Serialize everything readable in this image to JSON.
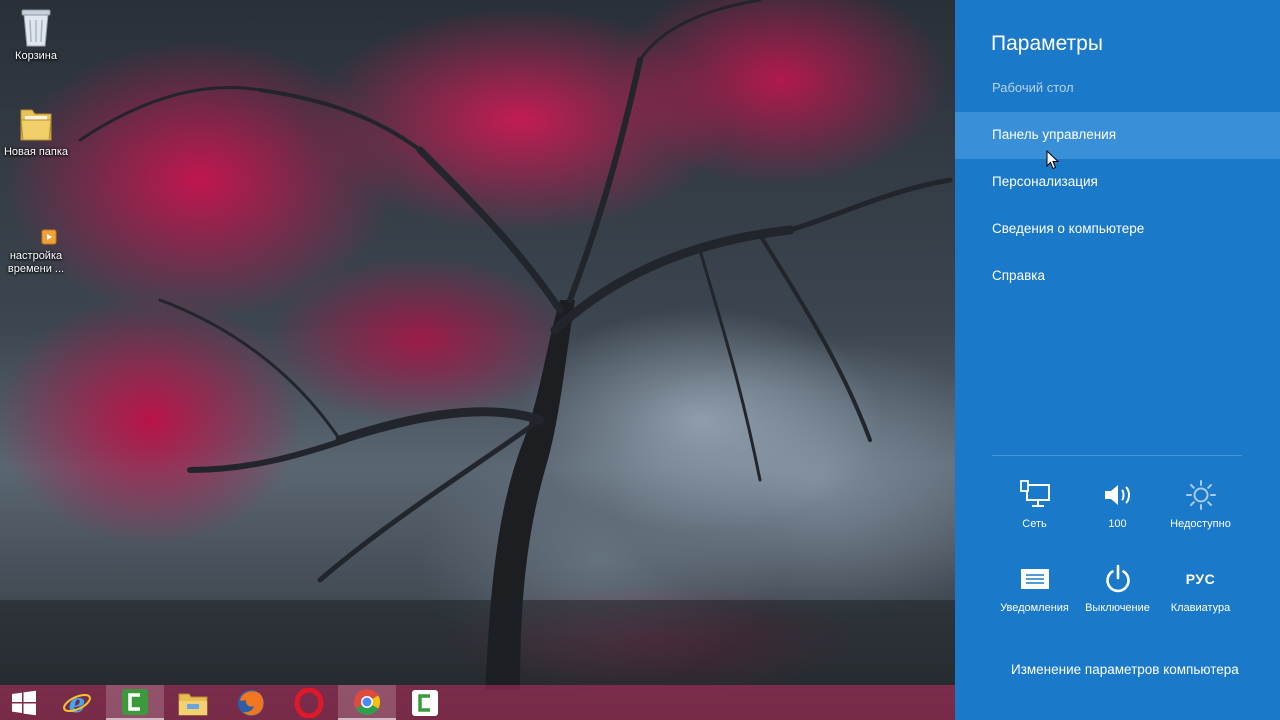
{
  "desktop": {
    "icons": [
      {
        "label": "Корзина",
        "icon": "recycle-bin-icon"
      },
      {
        "label": "Новая папка",
        "icon": "folder-icon"
      },
      {
        "label_line1": "настройка",
        "label_line2": "времени ...",
        "icon": "shortcut-icon"
      }
    ]
  },
  "taskbar": {
    "items": [
      {
        "icon": "windows-start-icon"
      },
      {
        "icon": "internet-explorer-icon"
      },
      {
        "icon": "camtasia-icon",
        "active": true
      },
      {
        "icon": "file-explorer-icon"
      },
      {
        "icon": "firefox-icon"
      },
      {
        "icon": "opera-icon"
      },
      {
        "icon": "chrome-icon",
        "active": true
      },
      {
        "icon": "camtasia-recorder-icon"
      }
    ]
  },
  "charm": {
    "title": "Параметры",
    "subtitle": "Рабочий стол",
    "items": [
      {
        "label": "Панель управления",
        "hover": true
      },
      {
        "label": "Персонализация"
      },
      {
        "label": "Сведения о компьютере"
      },
      {
        "label": "Справка"
      }
    ],
    "quick_settings": [
      {
        "label": "Сеть",
        "icon": "network-icon"
      },
      {
        "label": "100",
        "icon": "volume-icon"
      },
      {
        "label": "Недоступно",
        "icon": "brightness-icon"
      },
      {
        "label": "Уведомления",
        "icon": "notifications-icon"
      },
      {
        "label": "Выключение",
        "icon": "power-icon"
      },
      {
        "label": "Клавиатура",
        "icon": "keyboard-language-icon",
        "lang": "РУС"
      }
    ],
    "footer_link": "Изменение параметров компьютера"
  },
  "colors": {
    "charm_background": "#1a79c9",
    "charm_hover": "#3a90d8",
    "taskbar": "#962850"
  }
}
